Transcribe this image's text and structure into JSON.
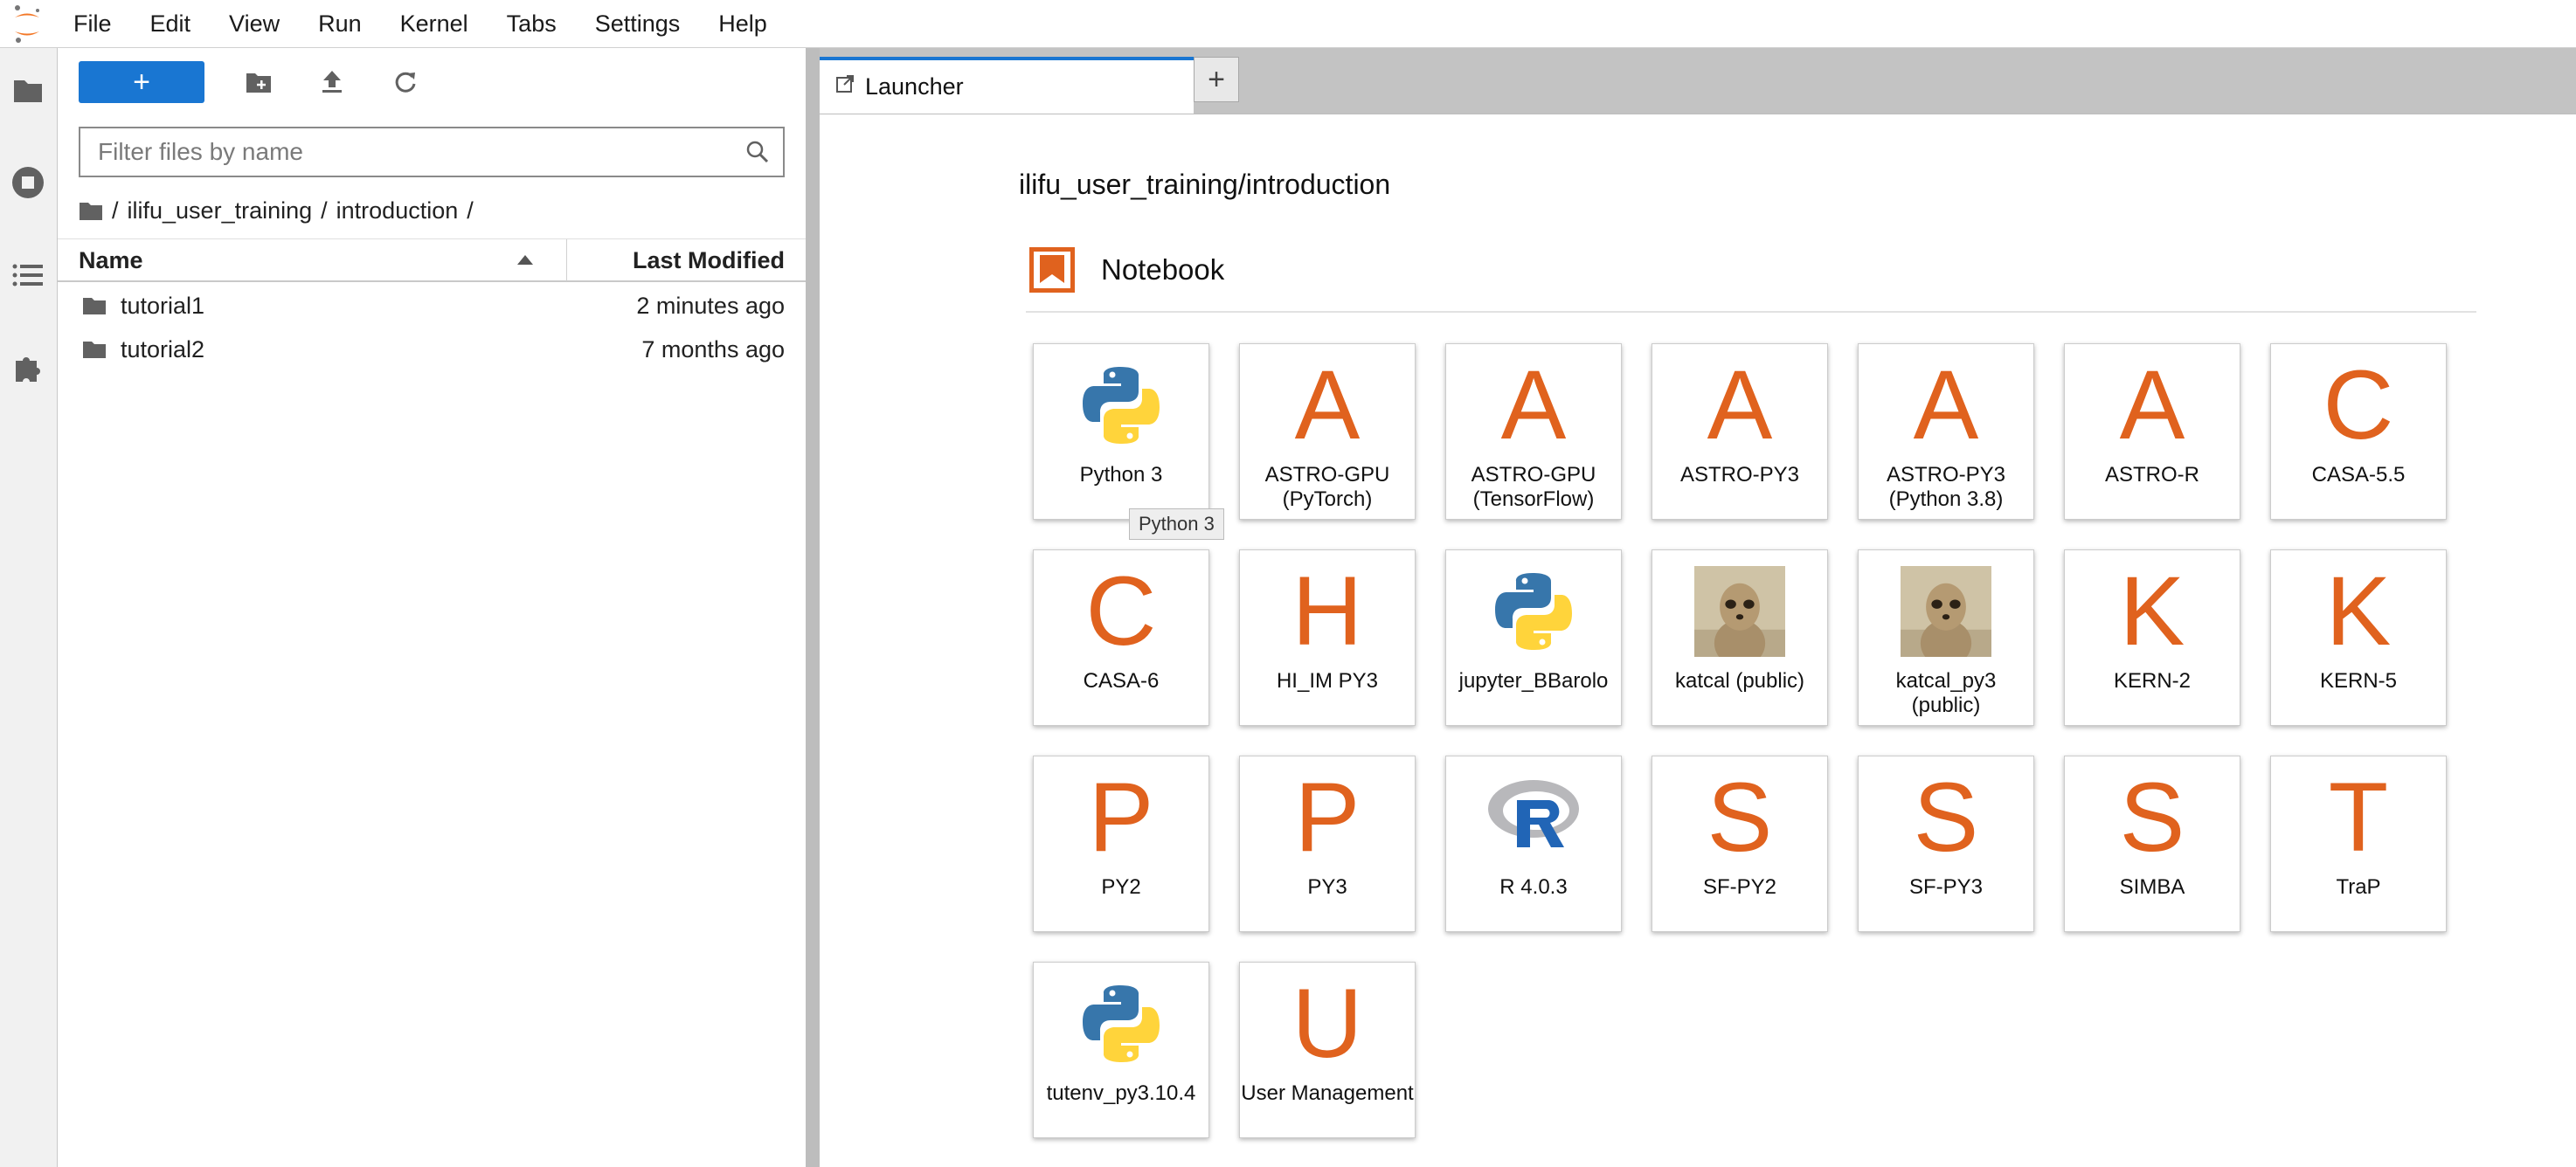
{
  "menu": [
    "File",
    "Edit",
    "View",
    "Run",
    "Kernel",
    "Tabs",
    "Settings",
    "Help"
  ],
  "filebrowser": {
    "new_label": "+",
    "filter_placeholder": "Filter files by name",
    "breadcrumb": [
      "/",
      "ilifu_user_training",
      "/",
      "introduction",
      "/"
    ],
    "columns": {
      "name": "Name",
      "modified": "Last Modified"
    },
    "rows": [
      {
        "name": "tutorial1",
        "modified": "2 minutes ago"
      },
      {
        "name": "tutorial2",
        "modified": "7 months ago"
      }
    ]
  },
  "tab": {
    "label": "Launcher",
    "add_label": "+"
  },
  "launcher": {
    "path": "ilifu_user_training/introduction",
    "section": "Notebook",
    "cards": [
      {
        "label": "Python 3",
        "icon": "python-logo"
      },
      {
        "label": "ASTRO-GPU (PyTorch)",
        "letter": "A"
      },
      {
        "label": "ASTRO-GPU (TensorFlow)",
        "letter": "A"
      },
      {
        "label": "ASTRO-PY3",
        "letter": "A"
      },
      {
        "label": "ASTRO-PY3 (Python 3.8)",
        "letter": "A"
      },
      {
        "label": "ASTRO-R",
        "letter": "A"
      },
      {
        "label": "CASA-5.5",
        "letter": "C"
      },
      {
        "label": "CASA-6",
        "letter": "C"
      },
      {
        "label": "HI_IM PY3",
        "letter": "H"
      },
      {
        "label": "jupyter_BBarolo",
        "icon": "python-logo"
      },
      {
        "label": "katcal (public)",
        "icon": "meerkat-photo"
      },
      {
        "label": "katcal_py3 (public)",
        "icon": "meerkat-photo"
      },
      {
        "label": "KERN-2",
        "letter": "K"
      },
      {
        "label": "KERN-5",
        "letter": "K"
      },
      {
        "label": "PY2",
        "letter": "P"
      },
      {
        "label": "PY3",
        "letter": "P"
      },
      {
        "label": "R 4.0.3",
        "icon": "r-logo"
      },
      {
        "label": "SF-PY2",
        "letter": "S"
      },
      {
        "label": "SF-PY3",
        "letter": "S"
      },
      {
        "label": "SIMBA",
        "letter": "S"
      },
      {
        "label": "TraP",
        "letter": "T"
      },
      {
        "label": "tutenv_py3.10.4",
        "icon": "python-logo"
      },
      {
        "label": "User Management",
        "letter": "U"
      }
    ],
    "tooltip": "Python 3"
  },
  "colors": {
    "accent": "#1976d2",
    "letter": "#e0621e",
    "notebook_icon": "#e0621e"
  }
}
